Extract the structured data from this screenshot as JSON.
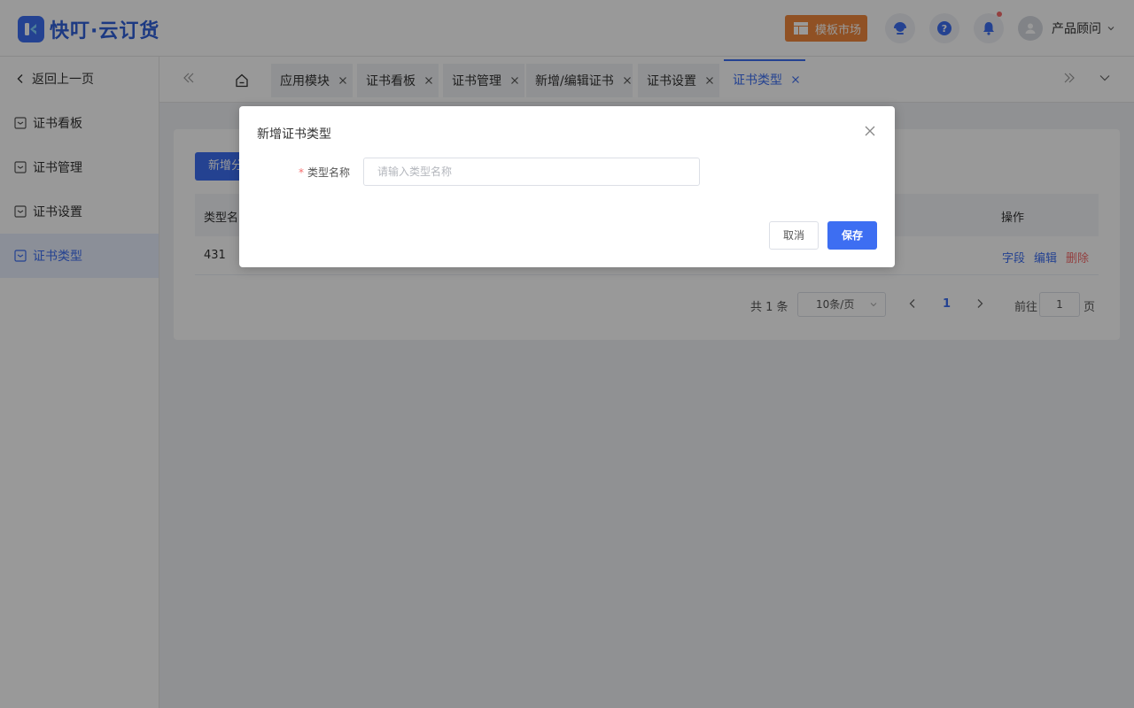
{
  "app": {
    "logo_text": "快叮·云订货"
  },
  "header": {
    "market_label": "模板市场",
    "user_name": "产品顾问"
  },
  "sidebar": {
    "back_label": "返回上一页",
    "items": [
      {
        "label": "证书看板"
      },
      {
        "label": "证书管理"
      },
      {
        "label": "证书设置"
      },
      {
        "label": "证书类型"
      }
    ]
  },
  "tabs": [
    {
      "label": "应用模块"
    },
    {
      "label": "证书看板"
    },
    {
      "label": "证书管理"
    },
    {
      "label": "新增/编辑证书"
    },
    {
      "label": "证书设置"
    },
    {
      "label": "证书类型"
    }
  ],
  "main": {
    "add_button_label": "新增分",
    "table": {
      "headers": {
        "name": "类型名",
        "ops": "操作"
      },
      "rows": [
        {
          "name": "431",
          "ops": [
            "字段",
            "编辑",
            "删除"
          ]
        }
      ]
    },
    "pagination": {
      "total": "共 1 条",
      "page_size": "10条/页",
      "current": "1",
      "goto_label": "前往",
      "goto_value": "1",
      "page_label": "页"
    }
  },
  "dialog": {
    "title": "新增证书类型",
    "field_label": "类型名称",
    "field_required_mark": "*",
    "field_placeholder": "请输入类型名称",
    "cancel_label": "取消",
    "save_label": "保存"
  },
  "colors": {
    "primary": "#3d6ef2",
    "danger": "#f56c6c",
    "market": "#f0883c"
  }
}
